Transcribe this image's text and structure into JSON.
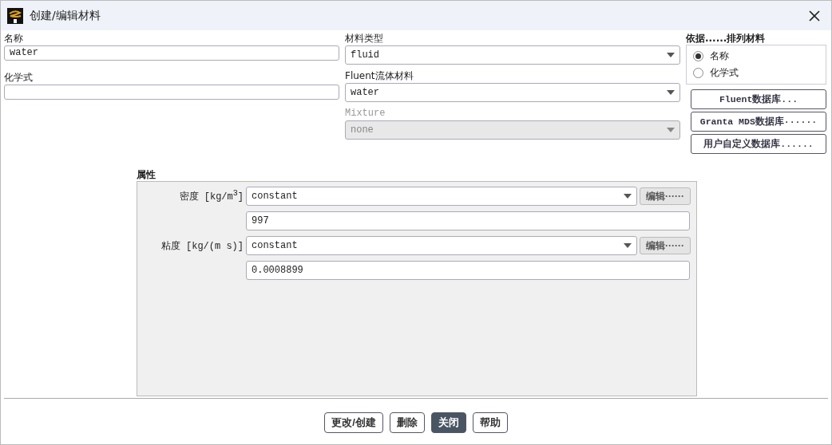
{
  "window": {
    "title": "创建/编辑材料"
  },
  "name": {
    "label": "名称",
    "value": "water"
  },
  "formula": {
    "label": "化学式"
  },
  "material_type": {
    "label": "材料类型",
    "value": "fluid",
    "disabled": false
  },
  "fluent_material": {
    "label": "Fluent流体材料",
    "value": "water",
    "disabled": false
  },
  "mixture": {
    "label": "Mixture",
    "value": "none",
    "disabled": true
  },
  "order_by": {
    "label": "依据......排列材料",
    "options": [
      {
        "label": "名称",
        "selected": true
      },
      {
        "label": "化学式",
        "selected": false
      }
    ]
  },
  "database_buttons": [
    "Fluent数据库...",
    "Granta MDS数据库······",
    "用户自定义数据库......"
  ],
  "properties": {
    "label": "属性",
    "items": [
      {
        "label": "密度 [kg/m$^{3}$]",
        "method": "constant",
        "edit": "编辑······",
        "value": "997"
      },
      {
        "label": "粘度 [kg/(m s)]",
        "method": "constant",
        "edit": "编辑······",
        "value": "0.0008899"
      }
    ]
  },
  "buttons": [
    {
      "label": "更改/创建",
      "default": false
    },
    {
      "label": "删除",
      "default": false
    },
    {
      "label": "关闭",
      "default": true
    },
    {
      "label": "帮助",
      "default": false
    }
  ]
}
